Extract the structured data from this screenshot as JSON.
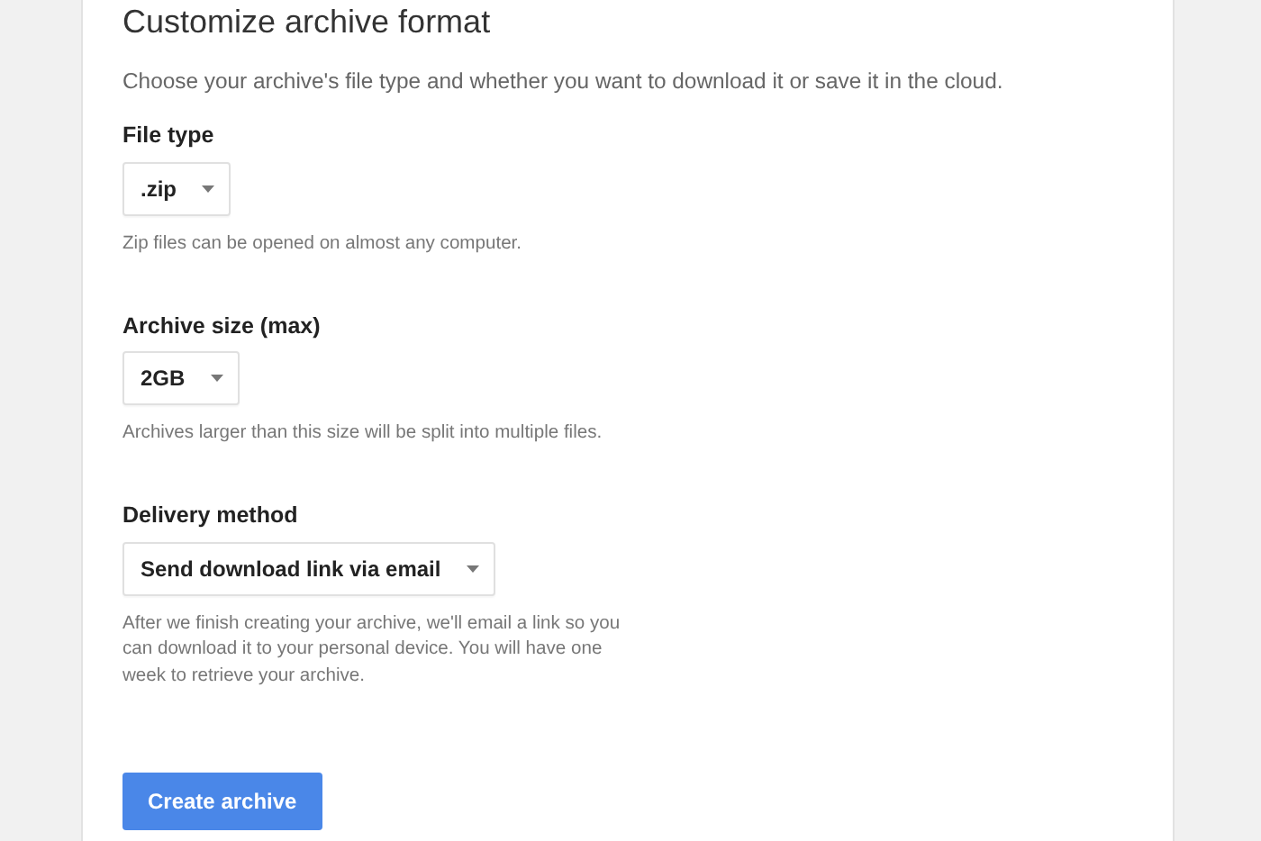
{
  "title": "Customize archive format",
  "description": "Choose your archive's file type and whether you want to download it or save it in the cloud.",
  "fields": [
    {
      "label": "File type",
      "value": ".zip",
      "hint": "Zip files can be opened on almost any computer."
    },
    {
      "label": "Archive size (max)",
      "value": "2GB",
      "hint": "Archives larger than this size will be split into multiple files."
    },
    {
      "label": "Delivery method",
      "value": "Send download link via email",
      "hint": "After we finish creating your archive, we'll email a link so you can download it to your personal device. You will have one week to retrieve your archive."
    }
  ],
  "button": "Create archive"
}
